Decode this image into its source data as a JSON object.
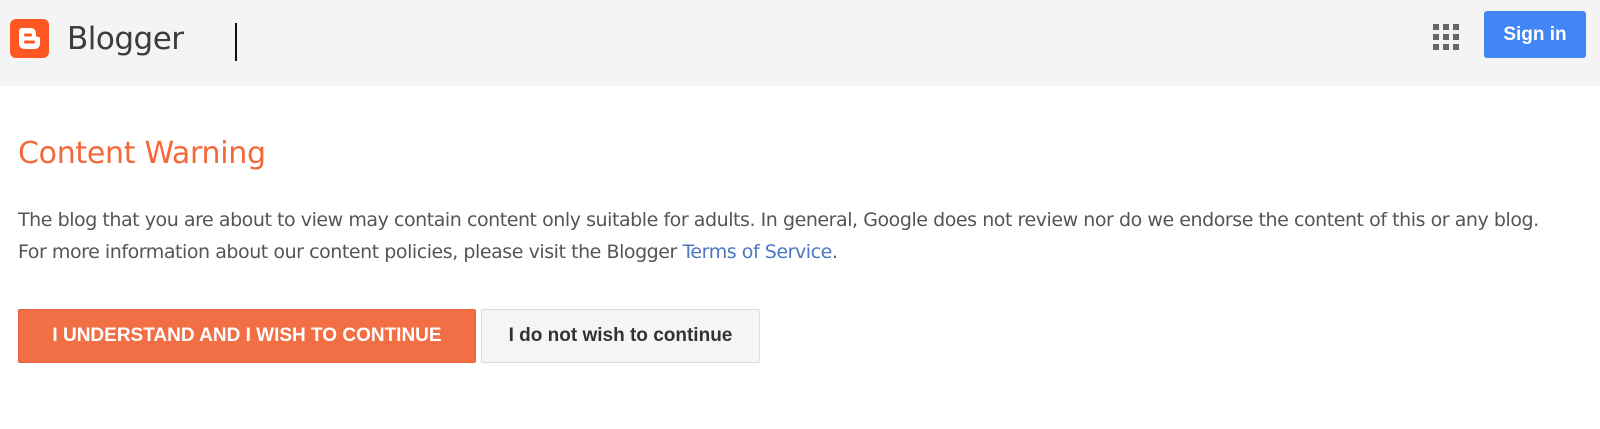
{
  "header": {
    "brand_name": "Blogger",
    "apps_icon": "apps-grid-icon",
    "signin_label": "Sign in",
    "colors": {
      "bar": "#f4f4f4",
      "logo": "#ff5722",
      "signin": "#4285f4"
    }
  },
  "main": {
    "title": "Content Warning",
    "paragraph_line1": "The blog that you are about to view may contain content only suitable for adults. In general, Google does not review nor do we endorse the content of this or any blog.",
    "paragraph_line2_prefix": "For more information about our content policies, please visit the Blogger ",
    "terms_link_label": "Terms of Service",
    "paragraph_line2_suffix": ".",
    "continue_label": "I UNDERSTAND AND I WISH TO CONTINUE",
    "decline_label": "I do not wish to continue",
    "colors": {
      "title": "#f4683a",
      "link": "#4b77be",
      "continue_button": "#f26e45"
    }
  }
}
